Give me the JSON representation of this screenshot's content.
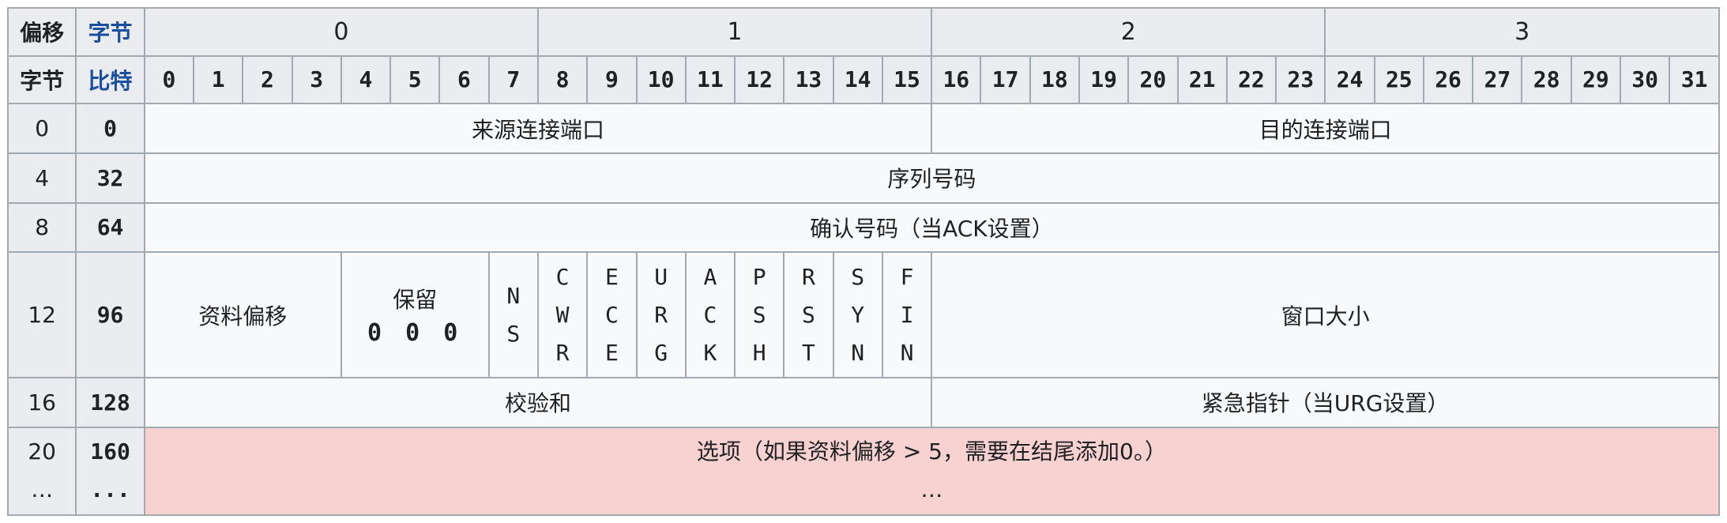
{
  "corner": {
    "offset_label": "偏移",
    "octet_label": "字节",
    "byte_label": "字节",
    "bit_label": "比特"
  },
  "octets": [
    "0",
    "1",
    "2",
    "3"
  ],
  "bits": [
    "0",
    "1",
    "2",
    "3",
    "4",
    "5",
    "6",
    "7",
    "8",
    "9",
    "10",
    "11",
    "12",
    "13",
    "14",
    "15",
    "16",
    "17",
    "18",
    "19",
    "20",
    "21",
    "22",
    "23",
    "24",
    "25",
    "26",
    "27",
    "28",
    "29",
    "30",
    "31"
  ],
  "rows": [
    {
      "byte": "0",
      "bit": "0"
    },
    {
      "byte": "4",
      "bit": "32"
    },
    {
      "byte": "8",
      "bit": "64"
    },
    {
      "byte": "12",
      "bit": "96"
    },
    {
      "byte": "16",
      "bit": "128"
    },
    {
      "byte": "20",
      "bit": "160",
      "byte2": "…",
      "bit2": "..."
    }
  ],
  "fields": {
    "source_port": "来源连接端口",
    "dest_port": "目的连接端口",
    "seq_number": "序列号码",
    "ack_number": "确认号码（当ACK设置）",
    "data_offset": "资料偏移",
    "reserved": "保留",
    "reserved_bits": "0 0 0",
    "window_size": "窗口大小",
    "checksum": "校验和",
    "urgent_pointer": "紧急指针（当URG设置）",
    "options": "选项（如果资料偏移 > 5，需要在结尾添加0。）",
    "options_cont": "…"
  },
  "flags": {
    "ns": [
      "N",
      "S"
    ],
    "cwr": [
      "C",
      "W",
      "R"
    ],
    "ece": [
      "E",
      "C",
      "E"
    ],
    "urg": [
      "U",
      "R",
      "G"
    ],
    "ack": [
      "A",
      "C",
      "K"
    ],
    "psh": [
      "P",
      "S",
      "H"
    ],
    "rst": [
      "R",
      "S",
      "T"
    ],
    "syn": [
      "S",
      "Y",
      "N"
    ],
    "fin": [
      "F",
      "I",
      "N"
    ]
  },
  "colors": {
    "header_bg": "#eaecf0",
    "cell_bg": "#f8f9fa",
    "options_bg": "#f8d1d1",
    "border": "#a2a9b1",
    "blue_label": "#1a4fa0"
  }
}
